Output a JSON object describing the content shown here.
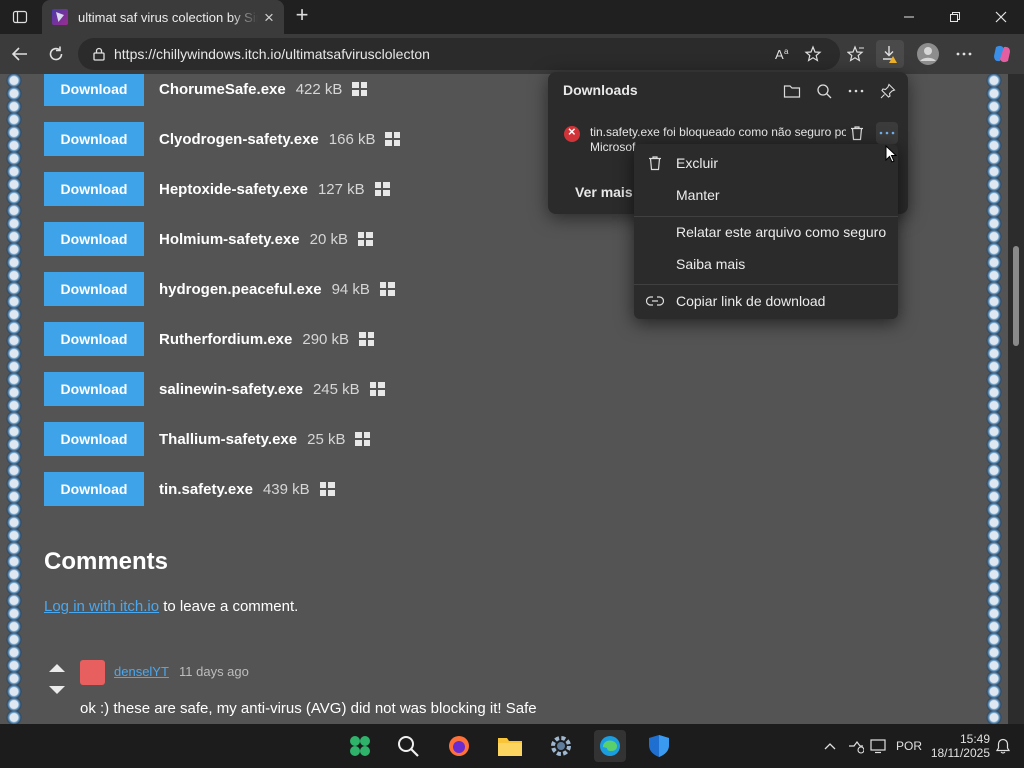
{
  "browser": {
    "tab_title": "ultimat saf virus colection by Simo",
    "url": "https://chillywindows.itch.io/ultimatsafvirusclolecton"
  },
  "files": [
    {
      "button": "Download",
      "name": "ChorumeSafe.exe",
      "size": "422 kB"
    },
    {
      "button": "Download",
      "name": "Clyodrogen-safety.exe",
      "size": "166 kB"
    },
    {
      "button": "Download",
      "name": "Heptoxide-safety.exe",
      "size": "127 kB"
    },
    {
      "button": "Download",
      "name": "Holmium-safety.exe",
      "size": "20 kB"
    },
    {
      "button": "Download",
      "name": "hydrogen.peaceful.exe",
      "size": "94 kB"
    },
    {
      "button": "Download",
      "name": "Rutherfordium.exe",
      "size": "290 kB"
    },
    {
      "button": "Download",
      "name": "salinewin-safety.exe",
      "size": "245 kB"
    },
    {
      "button": "Download",
      "name": "Thallium-safety.exe",
      "size": "25 kB"
    },
    {
      "button": "Download",
      "name": "tin.safety.exe",
      "size": "439 kB"
    }
  ],
  "comments": {
    "heading": "Comments",
    "login_link": "Log in with itch.io",
    "login_suffix": " to leave a comment.",
    "items": [
      {
        "author": "denselYT",
        "ago": "11 days ago",
        "text": "ok :) these are safe, my anti-virus (AVG) did not was blocking it! Safe"
      }
    ]
  },
  "downloads_panel": {
    "title": "Downloads",
    "item_text_line1": "tin.safety.exe foi bloqueado como não seguro po",
    "item_text_line2": "Microsof",
    "see_more": "Ver mais"
  },
  "context_menu": {
    "items": [
      "Excluir",
      "Manter",
      "Relatar este arquivo como seguro",
      "Saiba mais",
      "Copiar link de download"
    ]
  },
  "taskbar": {
    "language": "POR",
    "time": "15:49",
    "date": "18/11/2025"
  },
  "colors": {
    "download_button": "#3ea3e8",
    "link": "#4aa8f0",
    "page_bg": "#545454"
  }
}
